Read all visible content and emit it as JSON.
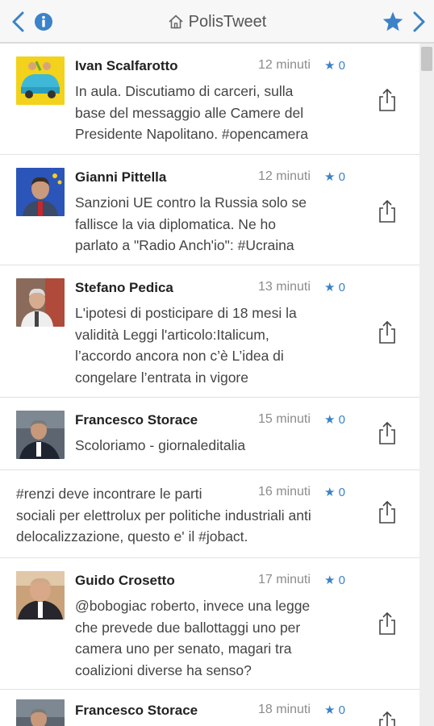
{
  "header": {
    "title": "PolisTweet"
  },
  "tweets": [
    {
      "name": "Ivan Scalfarotto",
      "time": "12 minuti",
      "favs": "★ 0",
      "lines": [
        "In aula. Discutiamo di carceri, sulla",
        "base del messaggio alle Camere del",
        "Presidente Napolitano. #opencamera"
      ]
    },
    {
      "name": "Gianni Pittella",
      "time": "12 minuti",
      "favs": "★ 0",
      "lines": [
        "Sanzioni UE contro la Russia solo se",
        "fallisce la via diplomatica. Ne ho",
        "parlato a \"Radio Anch'io\": #Ucraina"
      ]
    },
    {
      "name": "Stefano Pedica",
      "time": "13 minuti",
      "favs": "★ 0",
      "lines": [
        "L'ipotesi di posticipare di 18 mesi la",
        "validità Leggi l'articolo:Italicum,",
        "l’accordo ancora non c’è L’idea di",
        "congelare l’entrata in vigore"
      ]
    },
    {
      "name": "Francesco Storace",
      "time": "15 minuti",
      "favs": "★ 0",
      "lines": [
        "Scoloriamo - giornaleditalia"
      ]
    },
    {
      "name": "",
      "time": "16 minuti",
      "favs": "★ 0",
      "lines": [
        "#renzi deve incontrare le parti",
        "sociali per elettrolux per politiche industriali anti",
        "delocalizzazione, questo e' il #jobact."
      ]
    },
    {
      "name": "Guido Crosetto",
      "time": "17 minuti",
      "favs": "★ 0",
      "lines": [
        "@bobogiac roberto, invece una legge",
        "che prevede due ballottaggi uno per",
        "camera uno per senato, magari tra",
        "coalizioni diverse ha senso?"
      ]
    },
    {
      "name": "Francesco Storace",
      "time": "18 minuti",
      "favs": "★ 0",
      "lines": []
    }
  ],
  "colors": {
    "accent": "#3b82c8",
    "divider": "#e1e1e1"
  },
  "icons": {
    "back": "chevron-left-icon",
    "info": "info-icon",
    "home": "home-icon",
    "favorite": "star-icon",
    "forward": "chevron-right-icon",
    "share": "share-icon"
  }
}
